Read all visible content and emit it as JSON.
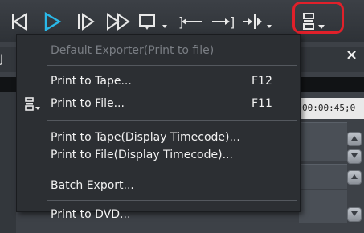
{
  "toolbar": {
    "buttons": [
      {
        "name": "prev-frame-icon"
      },
      {
        "name": "play-icon"
      },
      {
        "name": "next-frame-icon"
      },
      {
        "name": "fast-forward-icon"
      },
      {
        "name": "loop-playback-icon"
      },
      {
        "name": "set-in-icon"
      },
      {
        "name": "set-out-icon"
      },
      {
        "name": "split-icon"
      },
      {
        "name": "export-icon"
      }
    ],
    "accent_color": "#2ab8e8",
    "highlight_color": "#e0202a"
  },
  "panel": {
    "close_label": "×",
    "left_label": "J",
    "ruler_time": "00:00:45;0"
  },
  "menu": {
    "items": [
      {
        "label": "Default Exporter(Print to file)",
        "shortcut": "",
        "enabled": false
      },
      {
        "label": "Print to Tape...",
        "shortcut": "F12",
        "enabled": true
      },
      {
        "label": "Print to File...",
        "shortcut": "F11",
        "enabled": true
      },
      {
        "label": "Print to Tape(Display Timecode)...",
        "shortcut": "",
        "enabled": true
      },
      {
        "label": "Print to File(Display Timecode)...",
        "shortcut": "",
        "enabled": true
      },
      {
        "label": "Batch Export...",
        "shortcut": "",
        "enabled": true
      },
      {
        "label": "Print to DVD...",
        "shortcut": "",
        "enabled": true
      }
    ]
  }
}
